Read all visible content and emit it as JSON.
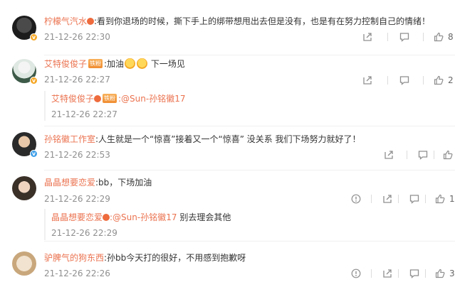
{
  "comments": [
    {
      "username": "柠檬气汽水",
      "text": ":看到你退场的时候，撕下手上的绑带想甩出去但是没有，也是有在努力控制自己的情绪！",
      "time": "21-12-26 22:30",
      "like_count": "8",
      "has_more_icon": false
    },
    {
      "username": "艾特俊俊子",
      "badge": "铁粉",
      "text_before": ":加油",
      "text_after": " 下一场见",
      "time": "21-12-26 22:27",
      "like_count": "2",
      "reply": {
        "username": "艾特俊俊子",
        "badge": "铁粉",
        "mention": ":@Sun-孙铭徽17",
        "time": "21-12-26 22:27"
      }
    },
    {
      "username": "孙铭徽工作室",
      "text": ":人生就是一个“惊喜”接着又一个“惊喜” 没关系 我们下场努力就好了！",
      "time": "21-12-26 22:53",
      "like_count": "",
      "verified": "blue"
    },
    {
      "username": "晶晶想要恋爱",
      "text": ":bb，下场加油",
      "time": "21-12-26 22:29",
      "like_count": "1",
      "reply": {
        "username": "晶晶想要恋爱",
        "mention": ":@Sun-孙铭徽17",
        "text": " 别去理会其他",
        "time": "21-12-26 22:29"
      }
    },
    {
      "username": "驴脾气的狗东西",
      "text": ":孙bb今天打的很好，不用感到抱歉呀",
      "time": "21-12-26 22:26",
      "like_count": "3"
    }
  ],
  "icons": {
    "share": "share-icon",
    "comment": "comment-icon",
    "like": "thumbs-up-icon",
    "report": "report-icon"
  },
  "colors": {
    "username": "#eb7350",
    "meta": "#8f8f8f",
    "badge_gold": "#f5a623",
    "badge_blue": "#3d9ee8"
  }
}
